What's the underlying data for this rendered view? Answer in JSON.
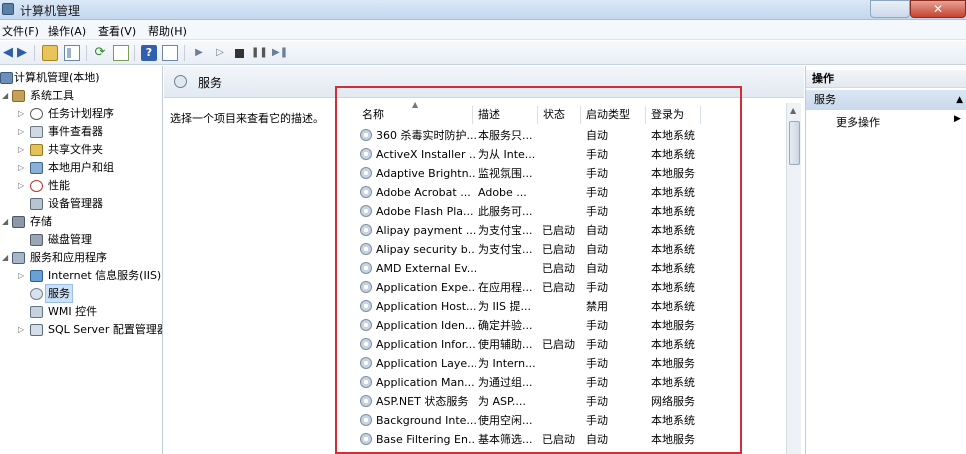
{
  "window": {
    "title": "计算机管理"
  },
  "menu": [
    {
      "label": "文件(F)"
    },
    {
      "label": "操作(A)"
    },
    {
      "label": "查看(V)"
    },
    {
      "label": "帮助(H)"
    }
  ],
  "toolbar": {
    "icons": [
      "back-arrow-icon",
      "forward-arrow-icon",
      "up-folder-icon",
      "show-pane-icon",
      "refresh-icon",
      "export-icon",
      "help-icon",
      "properties-icon",
      "start-service-icon",
      "start-alt-icon",
      "stop-service-icon",
      "pause-service-icon",
      "restart-service-icon"
    ]
  },
  "tree": [
    {
      "label": "计算机管理(本地)",
      "level": 0,
      "expander": "",
      "icon": "computer"
    },
    {
      "label": "系统工具",
      "level": 1,
      "expander": "◢",
      "icon": "tools"
    },
    {
      "label": "任务计划程序",
      "level": 2,
      "expander": "▷",
      "icon": "clock"
    },
    {
      "label": "事件查看器",
      "level": 2,
      "expander": "▷",
      "icon": "event"
    },
    {
      "label": "共享文件夹",
      "level": 2,
      "expander": "▷",
      "icon": "share"
    },
    {
      "label": "本地用户和组",
      "level": 2,
      "expander": "▷",
      "icon": "users"
    },
    {
      "label": "性能",
      "level": 2,
      "expander": "▷",
      "icon": "perf"
    },
    {
      "label": "设备管理器",
      "level": 2,
      "expander": "",
      "icon": "device"
    },
    {
      "label": "存储",
      "level": 1,
      "expander": "◢",
      "icon": "storage"
    },
    {
      "label": "磁盘管理",
      "level": 2,
      "expander": "",
      "icon": "disk"
    },
    {
      "label": "服务和应用程序",
      "level": 1,
      "expander": "◢",
      "icon": "apps"
    },
    {
      "label": "Internet 信息服务(IIS)管",
      "level": 2,
      "expander": "▷",
      "icon": "iis"
    },
    {
      "label": "服务",
      "level": 2,
      "expander": "",
      "icon": "gear",
      "selected": true
    },
    {
      "label": "WMI 控件",
      "level": 2,
      "expander": "",
      "icon": "wmi"
    },
    {
      "label": "SQL Server 配置管理器",
      "level": 2,
      "expander": "▷",
      "icon": "sql"
    }
  ],
  "middle": {
    "title": "服务",
    "description": "选择一个项目来查看它的描述。",
    "columns": [
      "名称",
      "描述",
      "状态",
      "启动类型",
      "登录为"
    ],
    "rows": [
      [
        "360 杀毒实时防护...",
        "本服务只...",
        "",
        "自动",
        "本地系统"
      ],
      [
        "ActiveX Installer ...",
        "为从 Inte...",
        "",
        "手动",
        "本地系统"
      ],
      [
        "Adaptive Brightn...",
        "监视氛围...",
        "",
        "手动",
        "本地服务"
      ],
      [
        "Adobe Acrobat ...",
        "Adobe ...",
        "",
        "手动",
        "本地系统"
      ],
      [
        "Adobe Flash Pla...",
        "此服务可...",
        "",
        "手动",
        "本地系统"
      ],
      [
        "Alipay payment ...",
        "为支付宝...",
        "已启动",
        "自动",
        "本地系统"
      ],
      [
        "Alipay security b...",
        "为支付宝...",
        "已启动",
        "自动",
        "本地系统"
      ],
      [
        "AMD External Ev...",
        "",
        "已启动",
        "自动",
        "本地系统"
      ],
      [
        "Application Expe...",
        "在应用程...",
        "已启动",
        "手动",
        "本地系统"
      ],
      [
        "Application Host...",
        "为 IIS 提...",
        "",
        "禁用",
        "本地系统"
      ],
      [
        "Application Iden...",
        "确定并验...",
        "",
        "手动",
        "本地服务"
      ],
      [
        "Application Infor...",
        "使用辅助...",
        "已启动",
        "手动",
        "本地系统"
      ],
      [
        "Application Laye...",
        "为 Intern...",
        "",
        "手动",
        "本地服务"
      ],
      [
        "Application Man...",
        "为通过组...",
        "",
        "手动",
        "本地系统"
      ],
      [
        "ASP.NET 状态服务",
        "为 ASP....",
        "",
        "手动",
        "网络服务"
      ],
      [
        "Background Inte...",
        "使用空闲...",
        "",
        "手动",
        "本地系统"
      ],
      [
        "Base Filtering En...",
        "基本筛选...",
        "已启动",
        "自动",
        "本地服务"
      ]
    ]
  },
  "actions": {
    "header": "操作",
    "section": "服务",
    "item": "更多操作"
  }
}
